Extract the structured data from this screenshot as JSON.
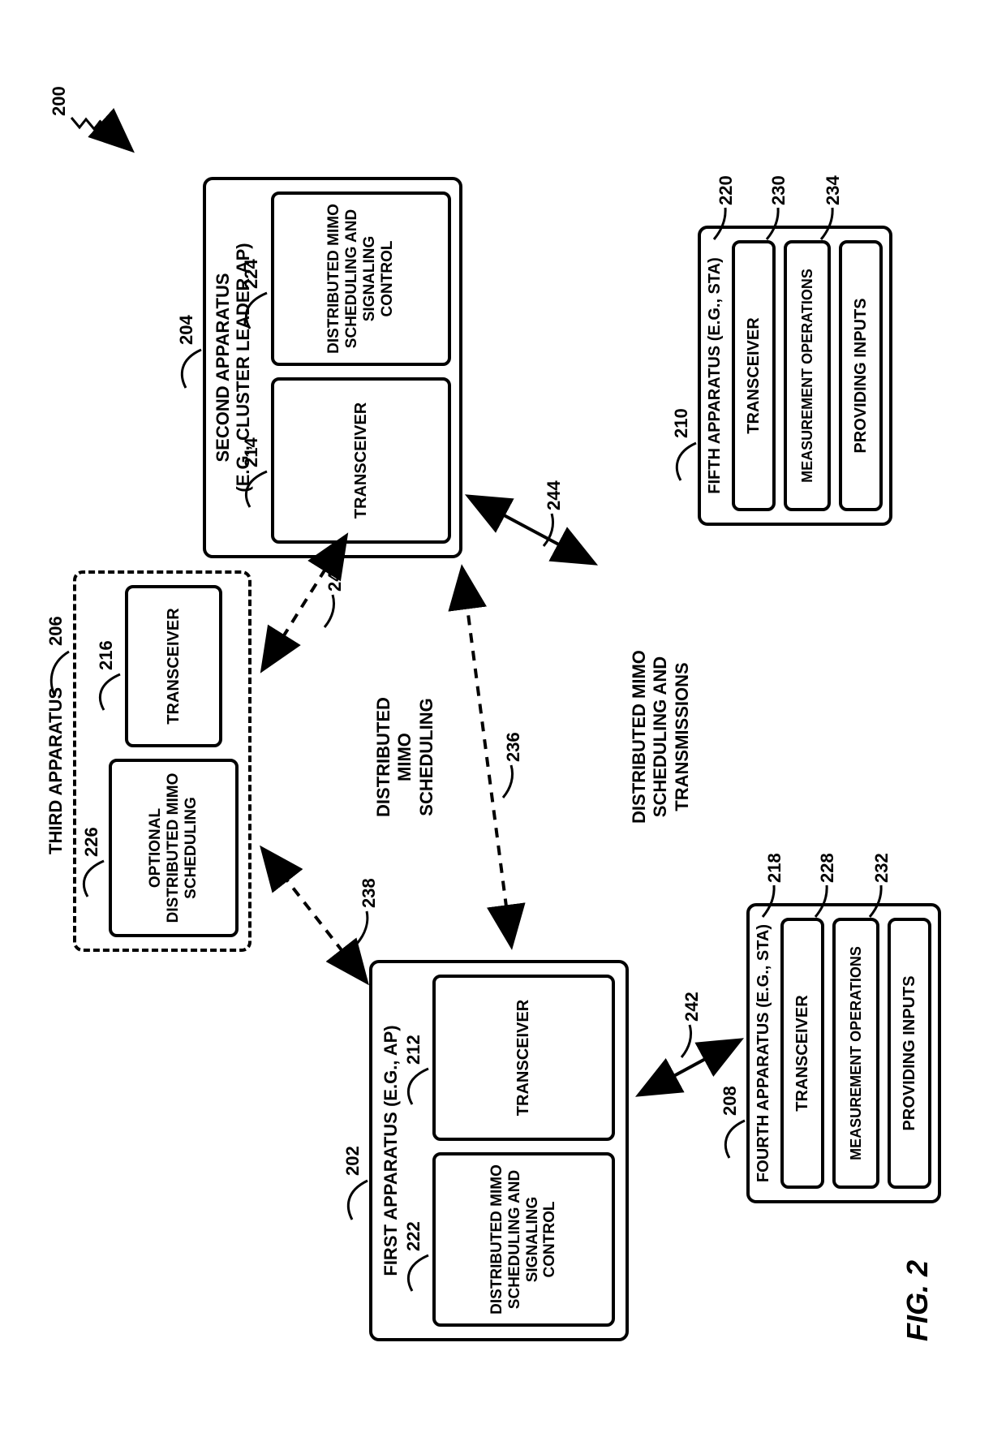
{
  "chart_data": {
    "type": "block-diagram",
    "figure": "FIG. 2",
    "system_ref": "200",
    "nodes": [
      {
        "id": "first_apparatus",
        "ref": "202",
        "title": "FIRST APPARATUS (E.G., AP)",
        "subblocks": [
          {
            "id": "first_dmimo",
            "ref": "222",
            "label": "DISTRIBUTED MIMO SCHEDULING AND SIGNALING CONTROL"
          },
          {
            "id": "first_transceiver",
            "ref": "212",
            "label": "TRANSCEIVER"
          }
        ]
      },
      {
        "id": "second_apparatus",
        "ref": "204",
        "title": "SECOND APPARATUS (E.G., CLUSTER LEADER AP)",
        "subblocks": [
          {
            "id": "second_transceiver",
            "ref": "214",
            "label": "TRANSCEIVER"
          },
          {
            "id": "second_dmimo",
            "ref": "224",
            "label": "DISTRIBUTED MIMO SCHEDULING AND SIGNALING CONTROL"
          }
        ]
      },
      {
        "id": "third_apparatus",
        "ref": "206",
        "title": "THIRD APPARATUS",
        "dashed": true,
        "subblocks": [
          {
            "id": "third_opt",
            "ref": "226",
            "label": "OPTIONAL DISTRIBUTED MIMO SCHEDULING",
            "dashed": true
          },
          {
            "id": "third_transceiver",
            "ref": "216",
            "label": "TRANSCEIVER"
          }
        ]
      },
      {
        "id": "fourth_apparatus",
        "ref": "208",
        "title": "FOURTH APPARATUS (E.G., STA)",
        "subblocks": [
          {
            "id": "fourth_transceiver",
            "ref": "218",
            "label": "TRANSCEIVER"
          },
          {
            "id": "fourth_meas",
            "ref": "228",
            "label": "MEASUREMENT OPERATIONS"
          },
          {
            "id": "fourth_inputs",
            "ref": "232",
            "label": "PROVIDING INPUTS"
          }
        ]
      },
      {
        "id": "fifth_apparatus",
        "ref": "210",
        "title": "FIFTH APPARATUS (E.G., STA)",
        "subblocks": [
          {
            "id": "fifth_transceiver",
            "ref": "220",
            "label": "TRANSCEIVER"
          },
          {
            "id": "fifth_meas",
            "ref": "230",
            "label": "MEASUREMENT OPERATIONS"
          },
          {
            "id": "fifth_inputs",
            "ref": "234",
            "label": "PROVIDING INPUTS"
          }
        ]
      }
    ],
    "links": [
      {
        "ref": "238",
        "from": "third_apparatus",
        "to": "first_apparatus",
        "style": "dashed"
      },
      {
        "ref": "240",
        "from": "third_apparatus",
        "to": "second_apparatus",
        "style": "dashed"
      },
      {
        "ref": "236",
        "from": "first_apparatus",
        "to": "second_apparatus",
        "style": "dashed",
        "label": "DISTRIBUTED MIMO SCHEDULING"
      },
      {
        "ref": "242",
        "from": "first_apparatus",
        "to": "fourth_apparatus",
        "style": "solid"
      },
      {
        "ref": "244",
        "from": "second_apparatus",
        "to": "fifth_apparatus",
        "style": "solid"
      }
    ],
    "annotations": [
      {
        "text": "DISTRIBUTED MIMO SCHEDULING AND TRANSMISSIONS"
      }
    ]
  },
  "figure_label": "FIG. 2",
  "system_ref": "200",
  "first": {
    "title": "FIRST APPARATUS (E.G., AP)",
    "ref": "202",
    "dmimo": {
      "label": "DISTRIBUTED MIMO SCHEDULING AND SIGNALING CONTROL",
      "ref": "222"
    },
    "transceiver": {
      "label": "TRANSCEIVER",
      "ref": "212"
    }
  },
  "second": {
    "title_line1": "SECOND APPARATUS",
    "title_line2": "(E.G., CLUSTER LEADER AP)",
    "ref": "204",
    "transceiver": {
      "label": "TRANSCEIVER",
      "ref": "214"
    },
    "dmimo": {
      "label": "DISTRIBUTED MIMO SCHEDULING AND SIGNALING CONTROL",
      "ref": "224"
    }
  },
  "third": {
    "title": "THIRD APPARATUS",
    "ref": "206",
    "opt": {
      "label": "OPTIONAL DISTRIBUTED MIMO SCHEDULING",
      "ref": "226"
    },
    "transceiver": {
      "label": "TRANSCEIVER",
      "ref": "216"
    }
  },
  "fourth": {
    "title": "FOURTH APPARATUS (E.G., STA)",
    "ref": "208",
    "transceiver": {
      "label": "TRANSCEIVER",
      "ref": "218"
    },
    "meas": {
      "label": "MEASUREMENT OPERATIONS",
      "ref": "228"
    },
    "inputs": {
      "label": "PROVIDING INPUTS",
      "ref": "232"
    }
  },
  "fifth": {
    "title": "FIFTH APPARATUS (E.G., STA)",
    "ref": "210",
    "transceiver": {
      "label": "TRANSCEIVER",
      "ref": "220"
    },
    "meas": {
      "label": "MEASUREMENT OPERATIONS",
      "ref": "230"
    },
    "inputs": {
      "label": "PROVIDING INPUTS",
      "ref": "234"
    }
  },
  "center_label_line1": "DISTRIBUTED",
  "center_label_line2": "MIMO",
  "center_label_line3": "SCHEDULING",
  "lower_label_line1": "DISTRIBUTED MIMO",
  "lower_label_line2": "SCHEDULING AND",
  "lower_label_line3": "TRANSMISSIONS",
  "link236": "236",
  "link238": "238",
  "link240": "240",
  "link242": "242",
  "link244": "244"
}
